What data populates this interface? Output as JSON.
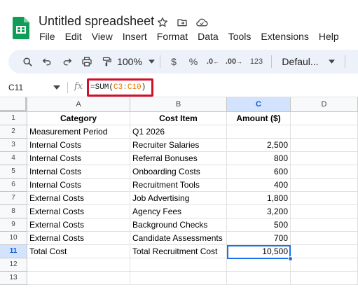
{
  "app": {
    "title": "Untitled spreadsheet",
    "accent_color": "#0F9D58",
    "icons": [
      "star-icon",
      "move-to-folder-icon",
      "cloud-saved-icon"
    ]
  },
  "menu": [
    "File",
    "Edit",
    "View",
    "Insert",
    "Format",
    "Data",
    "Tools",
    "Extensions",
    "Help"
  ],
  "toolbar": {
    "zoom": "100%",
    "currency_label": "$",
    "percent_label": "%",
    "decrease_decimal_label": ".0",
    "increase_decimal_label": ".00",
    "number_format_label": "123",
    "font_label": "Defaul..."
  },
  "formula_bar": {
    "name_box": "C11",
    "fx_label": "fx",
    "formula_prefix": "=SUM(",
    "formula_range": "C3:C10",
    "formula_suffix": ")",
    "highlight_color": "#d0102a"
  },
  "sheet": {
    "columns": [
      "A",
      "B",
      "C",
      "D"
    ],
    "selected_column": "C",
    "selected_row": "11",
    "row_numbers": [
      "1",
      "2",
      "3",
      "4",
      "5",
      "6",
      "7",
      "8",
      "9",
      "10",
      "11",
      "12",
      "13"
    ],
    "rows": [
      [
        "Category",
        "Cost Item",
        "Amount ($)",
        ""
      ],
      [
        "Measurement Period",
        "Q1 2026",
        "",
        ""
      ],
      [
        "Internal Costs",
        "Recruiter Salaries",
        "2,500",
        ""
      ],
      [
        "Internal Costs",
        "Referral Bonuses",
        "800",
        ""
      ],
      [
        "Internal Costs",
        "Onboarding Costs",
        "600",
        ""
      ],
      [
        "Internal Costs",
        "Recruitment Tools",
        "400",
        ""
      ],
      [
        "External Costs",
        "Job Advertising",
        "1,800",
        ""
      ],
      [
        "External Costs",
        "Agency Fees",
        "3,200",
        ""
      ],
      [
        "External Costs",
        "Background Checks",
        "500",
        ""
      ],
      [
        "External Costs",
        "Candidate Assessments",
        "700",
        ""
      ],
      [
        "Total Cost",
        "Total Recruitment Cost",
        "10,500",
        ""
      ],
      [
        "",
        "",
        "",
        ""
      ],
      [
        "",
        "",
        "",
        ""
      ]
    ]
  }
}
